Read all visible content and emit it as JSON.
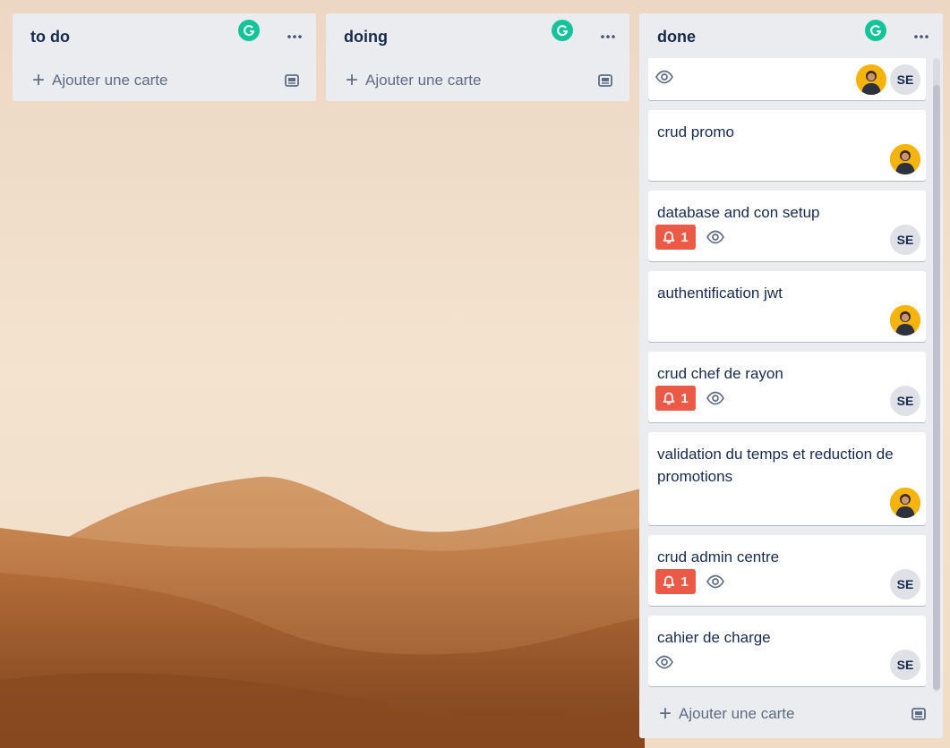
{
  "colors": {
    "list_bg": "#ebecf0",
    "card_bg": "#ffffff",
    "text": "#172b4d",
    "muted": "#5e6c84",
    "due_badge": "#eb5a46",
    "grammarly": "#15c39a",
    "member_bg": "#dfe1e6"
  },
  "lists": [
    {
      "title": "to do",
      "add_card_label": "Ajouter une carte"
    },
    {
      "title": "doing",
      "add_card_label": "Ajouter une carte"
    },
    {
      "title": "done",
      "add_card_label": "Ajouter une carte"
    }
  ],
  "done_cards": [
    {
      "title": "",
      "badges": {
        "watch": true
      },
      "members": [
        "photo",
        "SE"
      ]
    },
    {
      "title": "crud promo",
      "members": [
        "photo"
      ]
    },
    {
      "title": "database and con setup",
      "badges": {
        "due": "1",
        "watch": true
      },
      "members": [
        "SE"
      ]
    },
    {
      "title": "authentification jwt",
      "members": [
        "photo"
      ]
    },
    {
      "title": "crud chef de rayon",
      "badges": {
        "due": "1",
        "watch": true
      },
      "members": [
        "SE"
      ]
    },
    {
      "title": "validation du temps et reduction de promotions",
      "members": [
        "photo"
      ]
    },
    {
      "title": "crud admin centre",
      "badges": {
        "due": "1",
        "watch": true
      },
      "members": [
        "SE"
      ]
    },
    {
      "title": "cahier de charge",
      "badges": {
        "watch": true
      },
      "members": [
        "SE"
      ]
    }
  ],
  "member_initials": "SE",
  "icons": {
    "grammarly": "grammarly-icon",
    "list_menu": "ellipsis-icon",
    "add": "plus-icon",
    "template": "card-template-icon",
    "watch": "eye-icon",
    "due": "bell-icon"
  }
}
